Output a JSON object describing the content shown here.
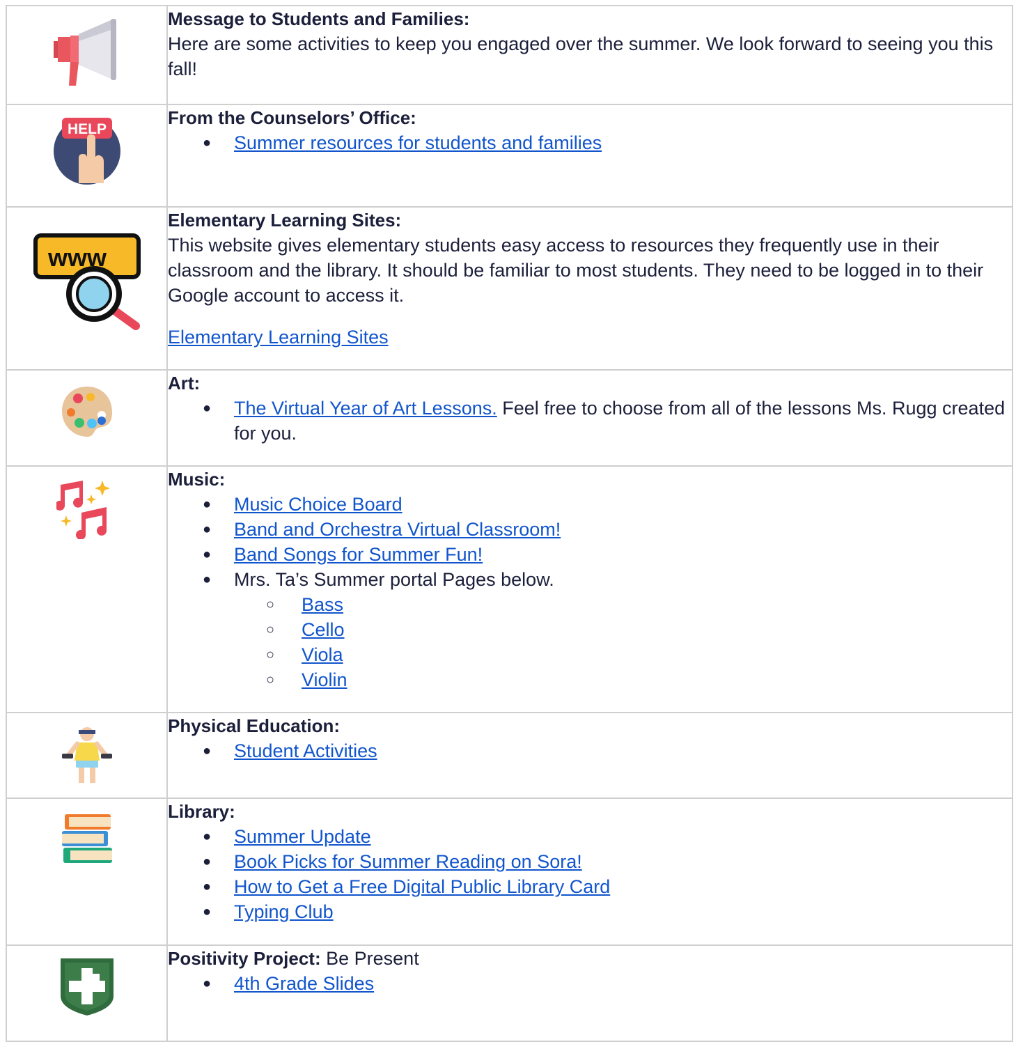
{
  "rows": {
    "message": {
      "icon": "megaphone-icon",
      "heading": "Message to Students and Families:",
      "body": "Here are some activities to keep you engaged over the summer. We look forward to seeing you this fall!"
    },
    "counselors": {
      "icon": "help-button-icon",
      "icon_text": "HELP",
      "heading": "From the Counselors’ Office:",
      "links": [
        "Summer resources for students and families"
      ]
    },
    "elementary": {
      "icon": "www-search-icon",
      "icon_text": "www",
      "heading": "Elementary Learning Sites:",
      "body": "This website gives elementary students easy access to resources they frequently use in their classroom and the library. It should be familiar to most students. They need to be logged in to their Google account to access it.",
      "link": "Elementary Learning Sites"
    },
    "art": {
      "icon": "paint-palette-icon",
      "heading": "Art:",
      "link": "The Virtual Year of Art Lessons.",
      "after_link": " Feel free to choose from all of the lessons Ms. Rugg created for you."
    },
    "music": {
      "icon": "music-notes-icon",
      "heading": "Music:",
      "links": [
        "Music Choice Board",
        "Band and Orchestra Virtual Classroom!",
        "Band Songs for Summer Fun!"
      ],
      "portal_text": "Mrs. Ta’s Summer portal Pages below.",
      "instruments": [
        "Bass",
        "Cello",
        "Viola",
        "Violin"
      ]
    },
    "pe": {
      "icon": "exercise-person-icon",
      "heading": "Physical Education:",
      "links": [
        "Student Activities"
      ]
    },
    "library": {
      "icon": "books-stack-icon",
      "heading": "Library:",
      "links": [
        "Summer Update",
        "Book Picks for Summer Reading on Sora!",
        "How to Get a Free Digital Public Library Card",
        "Typing Club"
      ]
    },
    "positivity": {
      "icon": "positivity-shield-icon",
      "heading": "Positivity Project:",
      "heading_rest": " Be Present",
      "links": [
        "4th Grade Slides"
      ]
    }
  },
  "colors": {
    "link": "#1155cc",
    "text": "#1b1f3a",
    "border": "#cfcfcf"
  }
}
